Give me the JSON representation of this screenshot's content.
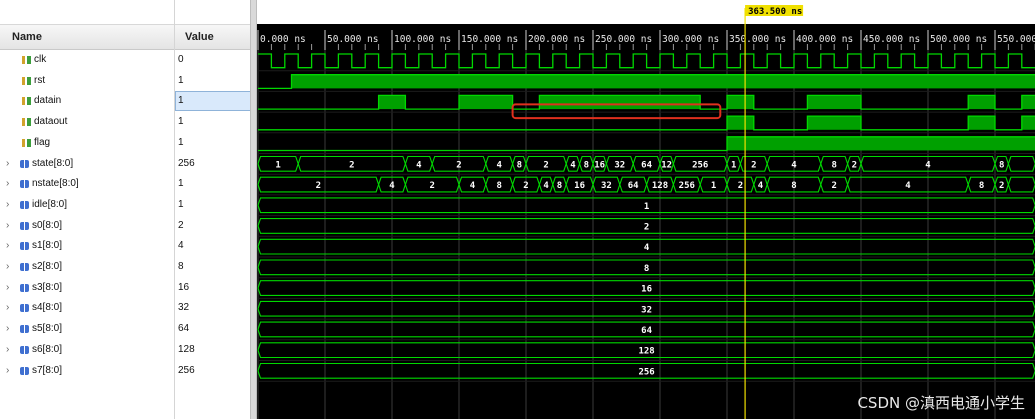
{
  "headers": {
    "name": "Name",
    "value": "Value"
  },
  "cursor_label": "363.500 ns",
  "time_ticks": [
    "0.000 ns",
    "50.000 ns",
    "100.000 ns",
    "150.000 ns",
    "200.000 ns",
    "250.000 ns",
    "300.000 ns",
    "350.000 ns",
    "400.000 ns",
    "450.000 ns",
    "500.000 ns",
    "550.000"
  ],
  "signals": [
    {
      "name": "clk",
      "value": "0",
      "kind": "bit"
    },
    {
      "name": "rst",
      "value": "1",
      "kind": "bit"
    },
    {
      "name": "datain",
      "value": "1",
      "kind": "bit",
      "selected": true
    },
    {
      "name": "dataout",
      "value": "1",
      "kind": "bit"
    },
    {
      "name": "flag",
      "value": "1",
      "kind": "bit"
    },
    {
      "name": "state[8:0]",
      "value": "256",
      "kind": "bus"
    },
    {
      "name": "nstate[8:0]",
      "value": "1",
      "kind": "bus"
    },
    {
      "name": "idle[8:0]",
      "value": "1",
      "kind": "bus"
    },
    {
      "name": "s0[8:0]",
      "value": "2",
      "kind": "bus"
    },
    {
      "name": "s1[8:0]",
      "value": "4",
      "kind": "bus"
    },
    {
      "name": "s2[8:0]",
      "value": "8",
      "kind": "bus"
    },
    {
      "name": "s3[8:0]",
      "value": "16",
      "kind": "bus"
    },
    {
      "name": "s4[8:0]",
      "value": "32",
      "kind": "bus"
    },
    {
      "name": "s5[8:0]",
      "value": "64",
      "kind": "bus"
    },
    {
      "name": "s6[8:0]",
      "value": "128",
      "kind": "bus"
    },
    {
      "name": "s7[8:0]",
      "value": "256",
      "kind": "bus"
    }
  ],
  "bus_labels": {
    "state": [
      "1",
      "2",
      "4",
      "2",
      "4",
      "8",
      "2",
      "4",
      "8",
      "16",
      "32",
      "64",
      "128",
      "256",
      "1",
      "2",
      "4",
      "8",
      "2",
      "4",
      "8"
    ],
    "nstate": [
      "2",
      "4",
      "2",
      "4",
      "8",
      "2",
      "4",
      "8",
      "16",
      "32",
      "64",
      "128",
      "256",
      "1",
      "2",
      "4",
      "8",
      "2",
      "4",
      "8",
      "2"
    ],
    "idle": "1",
    "s0": "2",
    "s1": "4",
    "s2": "8",
    "s3": "16",
    "s4": "32",
    "s5": "64",
    "s6": "128",
    "s7": "256"
  },
  "watermark": "CSDN @滇西电通小学生",
  "colors": {
    "wave": "#00d800",
    "fill": "#00a000",
    "cursor": "#f0e000",
    "highlight": "#e0301e"
  }
}
